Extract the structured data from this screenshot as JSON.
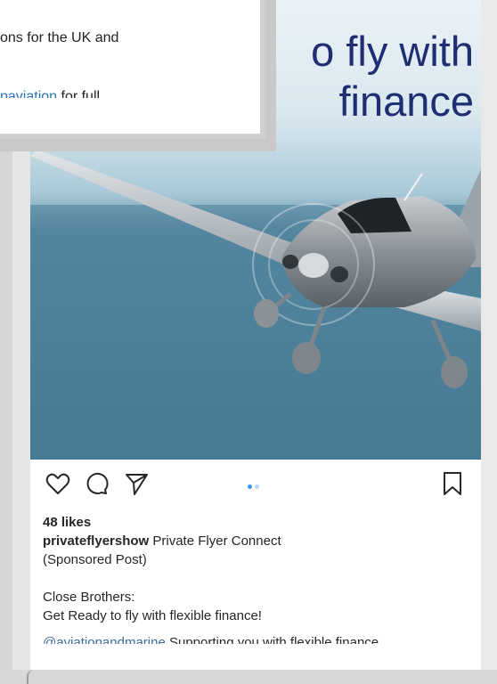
{
  "popup": {
    "line1": "ons for the UK and",
    "link_text": "paviation",
    "line3_rest": " for full"
  },
  "post": {
    "headline_line1": "o fly with",
    "headline_line2": "finance",
    "likes": "48 likes",
    "username": "privateflyershow",
    "caption_title": " Private Flyer Connect",
    "caption_sponsored": "(Sponsored Post)",
    "caption_company": "Close Brothers:",
    "caption_tagline": "Get Ready to fly with flexible finance!",
    "mention": "@aviationandmarine",
    "mention_rest": " Supporting you with flexible finance"
  },
  "icons": {
    "like": "heart-icon",
    "comment": "comment-icon",
    "share": "send-icon",
    "save": "bookmark-icon"
  },
  "colors": {
    "headline": "#1f2e73",
    "link": "#3897f0",
    "text": "#262626"
  }
}
